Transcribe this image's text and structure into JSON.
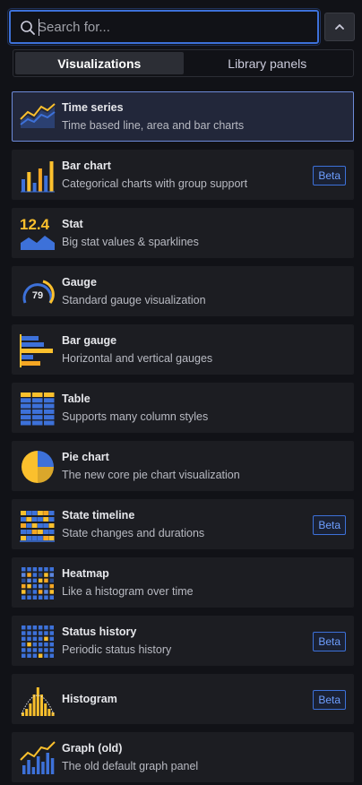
{
  "search": {
    "placeholder": "Search for..."
  },
  "tabs": [
    {
      "label": "Visualizations",
      "active": true
    },
    {
      "label": "Library panels",
      "active": false
    }
  ],
  "visualizations": [
    {
      "name": "Time series",
      "description": "Time based line, area and bar charts",
      "icon": "time-series-icon",
      "selected": true
    },
    {
      "name": "Bar chart",
      "description": "Categorical charts with group support",
      "icon": "bar-chart-icon",
      "badge": "Beta"
    },
    {
      "name": "Stat",
      "description": "Big stat values & sparklines",
      "icon": "stat-icon",
      "icon_value": "12.4"
    },
    {
      "name": "Gauge",
      "description": "Standard gauge visualization",
      "icon": "gauge-icon",
      "icon_value": "79"
    },
    {
      "name": "Bar gauge",
      "description": "Horizontal and vertical gauges",
      "icon": "bar-gauge-icon"
    },
    {
      "name": "Table",
      "description": "Supports many column styles",
      "icon": "table-icon"
    },
    {
      "name": "Pie chart",
      "description": "The new core pie chart visualization",
      "icon": "pie-chart-icon"
    },
    {
      "name": "State timeline",
      "description": "State changes and durations",
      "icon": "state-timeline-icon",
      "badge": "Beta"
    },
    {
      "name": "Heatmap",
      "description": "Like a histogram over time",
      "icon": "heatmap-icon"
    },
    {
      "name": "Status history",
      "description": "Periodic status history",
      "icon": "status-history-icon",
      "badge": "Beta"
    },
    {
      "name": "Histogram",
      "description": "",
      "icon": "histogram-icon",
      "badge": "Beta"
    },
    {
      "name": "Graph (old)",
      "description": "The old default graph panel",
      "icon": "graph-old-icon"
    }
  ],
  "colors": {
    "accent": "#3d71d9",
    "icon_blue": "#3d71d9",
    "icon_yellow": "#fbc02d",
    "icon_orange": "#f5a623",
    "badge_text": "#6e9fff"
  }
}
